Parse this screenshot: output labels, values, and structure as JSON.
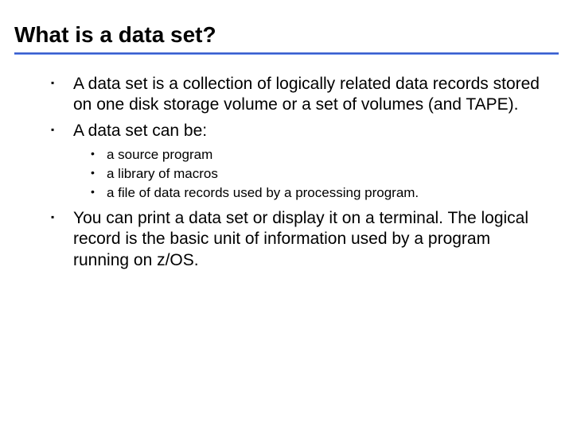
{
  "title": "What is a data set?",
  "bullets": {
    "b1": "A data set is a collection of logically related data records stored on one disk storage volume or a set of volumes (and TAPE).",
    "b2": "A data set can be:",
    "b3": "You can print a data set or display it on a terminal. The logical record is the basic unit of information used by a program running on z/OS."
  },
  "subbullets": {
    "s1": "a source program",
    "s2": "a library of macros",
    "s3": "a file of data records used by a processing program."
  }
}
